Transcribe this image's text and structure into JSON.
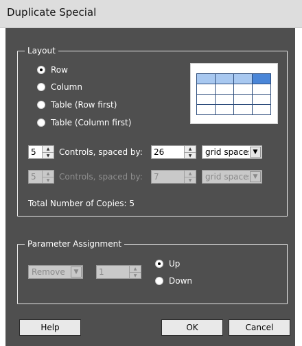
{
  "window": {
    "title": "Duplicate Special"
  },
  "layout_group": {
    "title": "Layout",
    "radios": [
      {
        "label": "Row",
        "checked": true
      },
      {
        "label": "Column",
        "checked": false
      },
      {
        "label": "Table (Row first)",
        "checked": false
      },
      {
        "label": "Table (Column first)",
        "checked": false
      }
    ],
    "row1": {
      "count": "5",
      "label": "Controls, spaced by:",
      "spacing": "26",
      "unit": "grid spaces"
    },
    "row2": {
      "count": "5",
      "label": "Controls, spaced by:",
      "spacing": "7",
      "unit": "grid spaces"
    },
    "total_label": "Total Number of Copies: 5"
  },
  "param_group": {
    "title": "Parameter Assignment",
    "action": "Remove",
    "value": "1",
    "radios": [
      {
        "label": "Up",
        "checked": true
      },
      {
        "label": "Down",
        "checked": false
      }
    ]
  },
  "buttons": {
    "help": "Help",
    "ok": "OK",
    "cancel": "Cancel"
  },
  "colors": {
    "panel": "#4f4f4f",
    "preview_header": "#a8c8f0",
    "preview_header_selected": "#4a86d8"
  }
}
